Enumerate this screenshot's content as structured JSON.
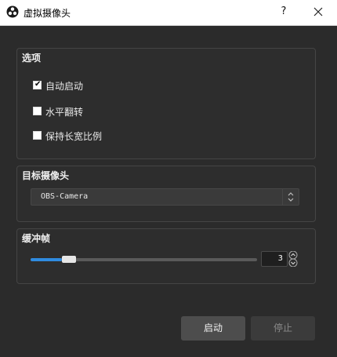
{
  "window": {
    "title": "虚拟摄像头",
    "help_label": "?",
    "icon": "obs-logo-icon",
    "close_icon": "close-icon"
  },
  "options": {
    "title": "选项",
    "checkboxes": [
      {
        "label": "自动启动",
        "checked": true
      },
      {
        "label": "水平翻转",
        "checked": false
      },
      {
        "label": "保持长宽比例",
        "checked": false
      }
    ]
  },
  "target": {
    "title": "目标摄像头",
    "selected": "OBS-Camera"
  },
  "buffer": {
    "title": "缓冲帧",
    "value": "3",
    "slider_fraction": 0.14
  },
  "buttons": {
    "start": "启动",
    "stop": "停止"
  },
  "colors": {
    "background": "#2b2b2b",
    "accent": "#2f8be0",
    "titlebar": "#ffffff"
  }
}
